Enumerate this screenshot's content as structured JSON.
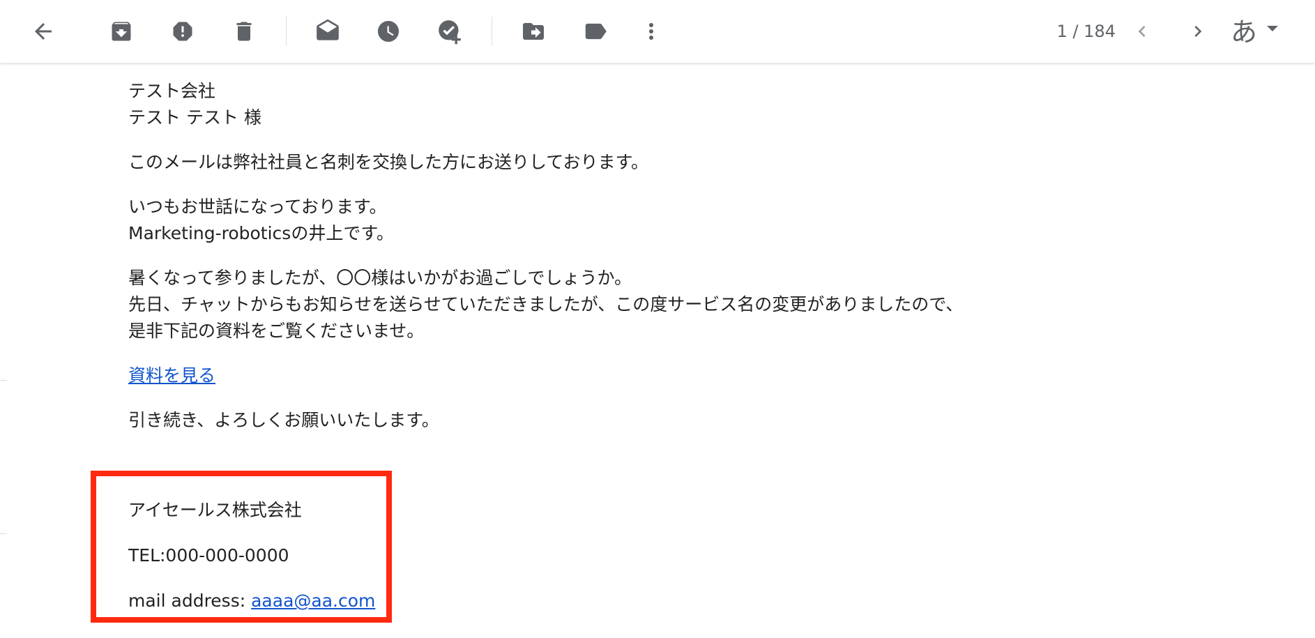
{
  "toolbar": {
    "icons": {
      "back": "arrow-back-icon",
      "archive": "archive-icon",
      "spam": "report-spam-icon",
      "delete": "trash-icon",
      "mark_unread": "mark-as-unread-icon",
      "snooze": "clock-icon",
      "add_task": "add-to-tasks-icon",
      "move": "move-to-icon",
      "label": "label-icon",
      "more": "more-vert-icon",
      "prev": "chevron-left-icon",
      "next": "chevron-right-icon"
    },
    "pager": "1 / 184",
    "input_tool": "あ"
  },
  "email": {
    "greeting": [
      "テスト会社",
      "テスト テスト 様"
    ],
    "intro": "このメールは弊社社員と名刺を交換した方にお送りしております。",
    "para1": [
      "いつもお世話になっております。",
      "Marketing-roboticsの井上です。"
    ],
    "para2": [
      "暑くなって参りましたが、〇〇様はいかがお過ごしでしょうか。",
      "先日、チャットからもお知らせを送らせていただきましたが、この度サービス名の変更がありましたので、",
      "是非下記の資料をご覧くださいませ。"
    ],
    "link_text": "資料を見る",
    "closing": "引き続き、よろしくお願いいたします。"
  },
  "signature": {
    "company": "アイセールス株式会社",
    "tel": "TEL:000-000-0000",
    "mail_label": "mail address: ",
    "mail": "aaaa@aa.com"
  },
  "colors": {
    "icon": "#5f6368",
    "link": "#1155cc",
    "highlight_border": "#ff2a10"
  }
}
